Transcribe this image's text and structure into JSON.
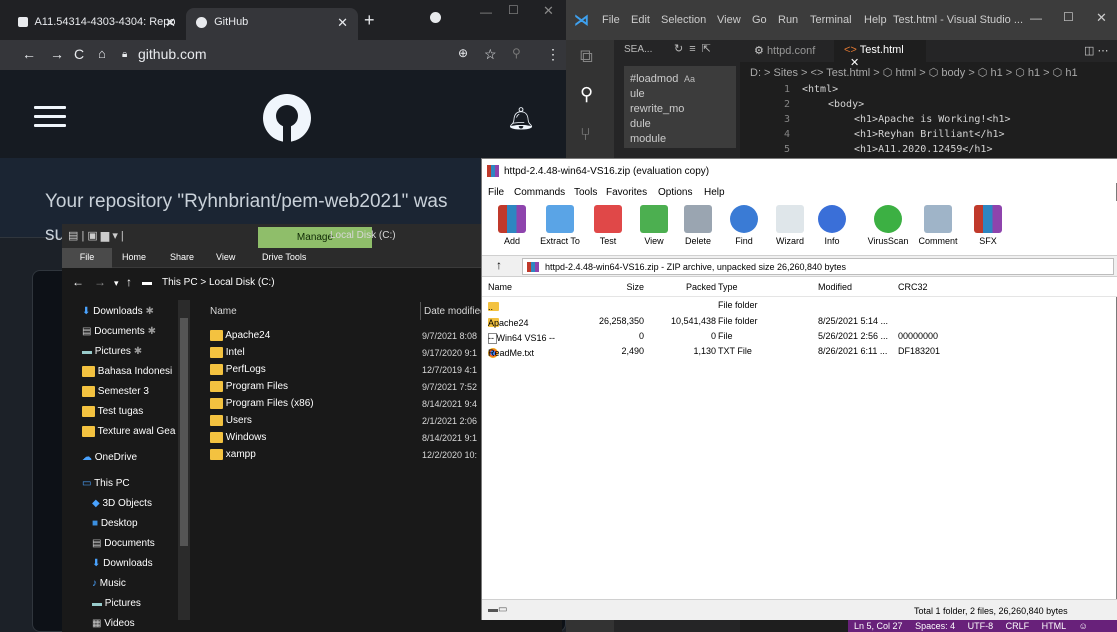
{
  "chrome": {
    "tabs": [
      {
        "label": "A11.54314-4303-4304: Repo"
      },
      {
        "label": "GitHub"
      }
    ],
    "url": "github.com",
    "banner_line1": "Your repository \"Ryhnbriant/pem-web2021\" was",
    "banner_line2": "su"
  },
  "vscode": {
    "menu": [
      "File",
      "Edit",
      "Selection",
      "View",
      "Go",
      "Run",
      "Terminal",
      "Help"
    ],
    "title": "Test.html - Visual Studio ...",
    "sidebar_title": "SEA...",
    "search_lines": [
      "#loadmod",
      "ule",
      "rewrite_mo",
      "dule",
      "module"
    ],
    "search_toggle": "Aa",
    "tabs": [
      {
        "label": "httpd.conf"
      },
      {
        "label": "Test.html"
      }
    ],
    "breadcrumb": "D: > Sites > <> Test.html > ⬡ html > ⬡ body > ⬡ h1 > ⬡ h1 > ⬡ h1",
    "lines": [
      {
        "num": "1",
        "text": "<html>"
      },
      {
        "num": "2",
        "text": "<body>"
      },
      {
        "num": "3",
        "text": "<h1>Apache is Working!<h1>"
      },
      {
        "num": "4",
        "text": "<h1>Reyhan Brilliant</h1>"
      },
      {
        "num": "5",
        "text": "<h1>A11.2020.12459</h1>"
      }
    ],
    "status": [
      "Ln 5, Col 27",
      "Spaces: 4",
      "UTF-8",
      "CRLF",
      "HTML"
    ]
  },
  "explorer": {
    "manage_label": "Manage",
    "title": "Local Disk (C:)",
    "ribbon": [
      "File",
      "Home",
      "Share",
      "View",
      "Drive Tools"
    ],
    "path": "This PC  >  Local Disk (C:)",
    "nav": [
      {
        "label": "Downloads"
      },
      {
        "label": "Documents"
      },
      {
        "label": "Pictures"
      },
      {
        "label": "Bahasa Indonesi"
      },
      {
        "label": "Semester 3"
      },
      {
        "label": "Test tugas"
      },
      {
        "label": "Texture awal Gea"
      },
      {
        "label": "OneDrive"
      },
      {
        "label": "This PC"
      },
      {
        "label": "3D Objects"
      },
      {
        "label": "Desktop"
      },
      {
        "label": "Documents"
      },
      {
        "label": "Downloads"
      },
      {
        "label": "Music"
      },
      {
        "label": "Pictures"
      },
      {
        "label": "Videos"
      }
    ],
    "columns": {
      "name": "Name",
      "date": "Date modified"
    },
    "rows": [
      {
        "name": "Apache24",
        "date": "9/7/2021 8:08"
      },
      {
        "name": "Intel",
        "date": "9/17/2020 9:1"
      },
      {
        "name": "PerfLogs",
        "date": "12/7/2019 4:1"
      },
      {
        "name": "Program Files",
        "date": "9/7/2021 7:52"
      },
      {
        "name": "Program Files (x86)",
        "date": "8/14/2021 9:4"
      },
      {
        "name": "Users",
        "date": "2/1/2021 2:06"
      },
      {
        "name": "Windows",
        "date": "8/14/2021 9:1"
      },
      {
        "name": "xampp",
        "date": "12/2/2020 10:"
      }
    ]
  },
  "winrar": {
    "title": "httpd-2.4.48-win64-VS16.zip (evaluation copy)",
    "menu": [
      "File",
      "Commands",
      "Tools",
      "Favorites",
      "Options",
      "Help"
    ],
    "toolbar": [
      "Add",
      "Extract To",
      "Test",
      "View",
      "Delete",
      "Find",
      "Wizard",
      "Info",
      "VirusScan",
      "Comment",
      "SFX"
    ],
    "path": "httpd-2.4.48-win64-VS16.zip - ZIP archive, unpacked size 26,260,840 bytes",
    "columns": [
      "Name",
      "Size",
      "Packed",
      "Type",
      "Modified",
      "CRC32"
    ],
    "rows": [
      {
        "name": "..",
        "size": "",
        "packed": "",
        "type": "File folder",
        "modified": "",
        "crc": ""
      },
      {
        "name": "Apache24",
        "size": "26,258,350",
        "packed": "10,541,438",
        "type": "File folder",
        "modified": "8/25/2021 5:14 ...",
        "crc": ""
      },
      {
        "name": "-- Win64 VS16 --",
        "size": "0",
        "packed": "0",
        "type": "File",
        "modified": "5/26/2021 2:56 ...",
        "crc": "00000000"
      },
      {
        "name": "ReadMe.txt",
        "size": "2,490",
        "packed": "1,130",
        "type": "TXT File",
        "modified": "8/26/2021 6:11 ...",
        "crc": "DF183201"
      }
    ],
    "status": "Total 1 folder, 2 files, 26,260,840 bytes"
  }
}
